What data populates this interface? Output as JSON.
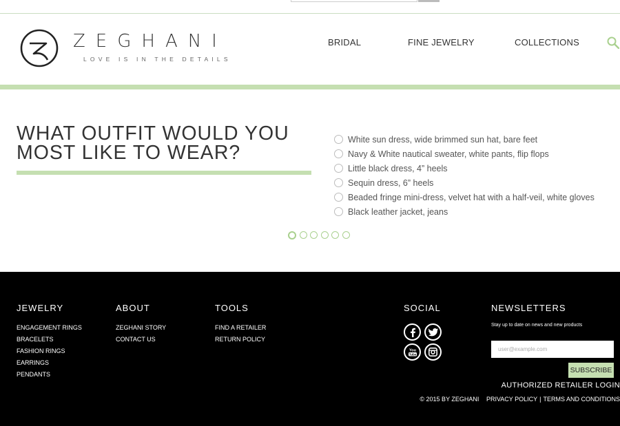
{
  "header": {
    "brand": "ZEGHANI",
    "tagline": "LOVE IS IN THE DETAILS",
    "nav": [
      "BRIDAL",
      "FINE JEWELRY",
      "COLLECTIONS"
    ]
  },
  "quiz": {
    "question": "WHAT OUTFIT WOULD YOU MOST LIKE TO WEAR?",
    "answers": [
      "White sun dress, wide brimmed sun hat, bare feet",
      "Navy & White nautical sweater, white pants, flip flops",
      "Little black dress, 4” heels",
      "Sequin dress, 6” heels",
      "Beaded fringe mini-dress, velvet hat with a half-veil, white gloves",
      "Black leather jacket, jeans"
    ],
    "current_step": 1,
    "total_steps": 6
  },
  "footer": {
    "jewelry": {
      "title": "JEWELRY",
      "links": [
        "ENGAGEMENT RINGS",
        "BRACELETS",
        "FASHION RINGS",
        "EARRINGS",
        "PENDANTS"
      ]
    },
    "about": {
      "title": "ABOUT",
      "links": [
        "ZEGHANI STORY",
        "CONTACT US"
      ]
    },
    "tools": {
      "title": "TOOLS",
      "links": [
        "FIND A RETAILER",
        "RETURN POLICY"
      ]
    },
    "social": {
      "title": "SOCIAL",
      "icons": [
        "facebook-icon",
        "twitter-icon",
        "youtube-icon",
        "instagram-icon"
      ]
    },
    "newsletters": {
      "title": "NEWSLETTERS",
      "description": "Stay up to date on news and new products",
      "placeholder": "user@example.com",
      "button": "SUBSCRIBE"
    },
    "retailer_login": "AUTHORIZED RETAILER LOGIN",
    "copyright": "© 2015 BY ZEGHANI",
    "privacy": "PRIVACY POLICY",
    "separator": "|",
    "terms": "TERMS AND CONDITIONS"
  },
  "colors": {
    "accent_green": "#c5dfb1",
    "footer_bg": "#000000",
    "text": "#333333"
  }
}
